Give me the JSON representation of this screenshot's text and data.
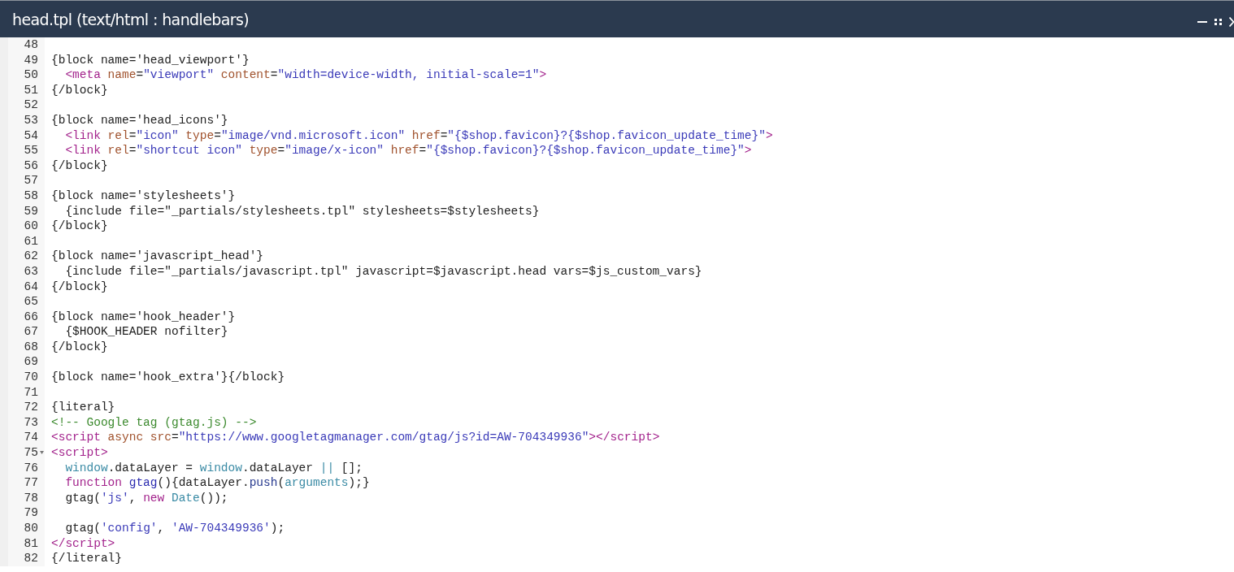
{
  "window": {
    "title": "head.tpl (text/html : handlebars)"
  },
  "editor": {
    "lines": [
      {
        "number": "48",
        "foldable": false
      },
      {
        "number": "49",
        "foldable": false,
        "tokens": [
          {
            "kind": "plain",
            "text": "{block name='head_viewport'}"
          }
        ]
      },
      {
        "number": "50",
        "foldable": false,
        "tokens": [
          {
            "kind": "tag",
            "text": "  <meta"
          },
          {
            "kind": "attr",
            "text": " name"
          },
          {
            "kind": "plain",
            "text": "="
          },
          {
            "kind": "string",
            "text": "\"viewport\""
          },
          {
            "kind": "attr",
            "text": " content"
          },
          {
            "kind": "plain",
            "text": "="
          },
          {
            "kind": "string",
            "text": "\"width=device-width, initial-scale=1\""
          },
          {
            "kind": "tag",
            "text": ">"
          }
        ]
      },
      {
        "number": "51",
        "foldable": false,
        "tokens": [
          {
            "kind": "plain",
            "text": "{/block}"
          }
        ]
      },
      {
        "number": "52",
        "foldable": false
      },
      {
        "number": "53",
        "foldable": false,
        "tokens": [
          {
            "kind": "plain",
            "text": "{block name='head_icons'}"
          }
        ]
      },
      {
        "number": "54",
        "foldable": false,
        "tokens": [
          {
            "kind": "tag",
            "text": "  <link"
          },
          {
            "kind": "attr",
            "text": " rel"
          },
          {
            "kind": "plain",
            "text": "="
          },
          {
            "kind": "string",
            "text": "\"icon\""
          },
          {
            "kind": "attr",
            "text": " type"
          },
          {
            "kind": "plain",
            "text": "="
          },
          {
            "kind": "string",
            "text": "\"image/vnd.microsoft.icon\""
          },
          {
            "kind": "attr",
            "text": " href"
          },
          {
            "kind": "plain",
            "text": "="
          },
          {
            "kind": "string",
            "text": "\"{$shop.favicon}?{$shop.favicon_update_time}\""
          },
          {
            "kind": "tag",
            "text": ">"
          }
        ]
      },
      {
        "number": "55",
        "foldable": false,
        "tokens": [
          {
            "kind": "tag",
            "text": "  <link"
          },
          {
            "kind": "attr",
            "text": " rel"
          },
          {
            "kind": "plain",
            "text": "="
          },
          {
            "kind": "string",
            "text": "\"shortcut icon\""
          },
          {
            "kind": "attr",
            "text": " type"
          },
          {
            "kind": "plain",
            "text": "="
          },
          {
            "kind": "string",
            "text": "\"image/x-icon\""
          },
          {
            "kind": "attr",
            "text": " href"
          },
          {
            "kind": "plain",
            "text": "="
          },
          {
            "kind": "string",
            "text": "\"{$shop.favicon}?{$shop.favicon_update_time}\""
          },
          {
            "kind": "tag",
            "text": ">"
          }
        ]
      },
      {
        "number": "56",
        "foldable": false,
        "tokens": [
          {
            "kind": "plain",
            "text": "{/block}"
          }
        ]
      },
      {
        "number": "57",
        "foldable": false
      },
      {
        "number": "58",
        "foldable": false,
        "tokens": [
          {
            "kind": "plain",
            "text": "{block name='stylesheets'}"
          }
        ]
      },
      {
        "number": "59",
        "foldable": false,
        "tokens": [
          {
            "kind": "plain",
            "text": "  {include file=\"_partials/stylesheets.tpl\" stylesheets=$stylesheets}"
          }
        ]
      },
      {
        "number": "60",
        "foldable": false,
        "tokens": [
          {
            "kind": "plain",
            "text": "{/block}"
          }
        ]
      },
      {
        "number": "61",
        "foldable": false
      },
      {
        "number": "62",
        "foldable": false,
        "tokens": [
          {
            "kind": "plain",
            "text": "{block name='javascript_head'}"
          }
        ]
      },
      {
        "number": "63",
        "foldable": false,
        "tokens": [
          {
            "kind": "plain",
            "text": "  {include file=\"_partials/javascript.tpl\" javascript=$javascript.head vars=$js_custom_vars}"
          }
        ]
      },
      {
        "number": "64",
        "foldable": false,
        "tokens": [
          {
            "kind": "plain",
            "text": "{/block}"
          }
        ]
      },
      {
        "number": "65",
        "foldable": false
      },
      {
        "number": "66",
        "foldable": false,
        "tokens": [
          {
            "kind": "plain",
            "text": "{block name='hook_header'}"
          }
        ]
      },
      {
        "number": "67",
        "foldable": false,
        "tokens": [
          {
            "kind": "plain",
            "text": "  {$HOOK_HEADER nofilter}"
          }
        ]
      },
      {
        "number": "68",
        "foldable": false,
        "tokens": [
          {
            "kind": "plain",
            "text": "{/block}"
          }
        ]
      },
      {
        "number": "69",
        "foldable": false
      },
      {
        "number": "70",
        "foldable": false,
        "tokens": [
          {
            "kind": "plain",
            "text": "{block name='hook_extra'}{/block}"
          }
        ]
      },
      {
        "number": "71",
        "foldable": false
      },
      {
        "number": "72",
        "foldable": false,
        "tokens": [
          {
            "kind": "plain",
            "text": "{literal}"
          }
        ]
      },
      {
        "number": "73",
        "foldable": false,
        "tokens": [
          {
            "kind": "comment",
            "text": "<!-- Google tag (gtag.js) -->"
          }
        ]
      },
      {
        "number": "74",
        "foldable": false,
        "tokens": [
          {
            "kind": "tag",
            "text": "<script"
          },
          {
            "kind": "attr",
            "text": " async"
          },
          {
            "kind": "attr",
            "text": " src"
          },
          {
            "kind": "plain",
            "text": "="
          },
          {
            "kind": "string",
            "text": "\"https://www.googletagmanager.com/gtag/js?id=AW-704349936\""
          },
          {
            "kind": "tag",
            "text": "></script>"
          }
        ]
      },
      {
        "number": "75",
        "foldable": true,
        "tokens": [
          {
            "kind": "tag",
            "text": "<script>"
          }
        ]
      },
      {
        "number": "76",
        "foldable": false,
        "tokens": [
          {
            "kind": "variable",
            "text": "  window"
          },
          {
            "kind": "plain",
            "text": ".dataLayer = "
          },
          {
            "kind": "variable",
            "text": "window"
          },
          {
            "kind": "plain",
            "text": ".dataLayer "
          },
          {
            "kind": "operator",
            "text": "||"
          },
          {
            "kind": "plain",
            "text": " [];"
          }
        ]
      },
      {
        "number": "77",
        "foldable": false,
        "tokens": [
          {
            "kind": "keyword",
            "text": "  function"
          },
          {
            "kind": "def",
            "text": " gtag"
          },
          {
            "kind": "plain",
            "text": "(){dataLayer."
          },
          {
            "kind": "property",
            "text": "push"
          },
          {
            "kind": "plain",
            "text": "("
          },
          {
            "kind": "variable",
            "text": "arguments"
          },
          {
            "kind": "plain",
            "text": ");}"
          }
        ]
      },
      {
        "number": "78",
        "foldable": false,
        "tokens": [
          {
            "kind": "plain",
            "text": "  gtag("
          },
          {
            "kind": "string",
            "text": "'js'"
          },
          {
            "kind": "plain",
            "text": ", "
          },
          {
            "kind": "keyword",
            "text": "new"
          },
          {
            "kind": "variable",
            "text": " Date"
          },
          {
            "kind": "plain",
            "text": "());"
          }
        ]
      },
      {
        "number": "79",
        "foldable": false
      },
      {
        "number": "80",
        "foldable": false,
        "tokens": [
          {
            "kind": "plain",
            "text": "  gtag("
          },
          {
            "kind": "string",
            "text": "'config'"
          },
          {
            "kind": "plain",
            "text": ", "
          },
          {
            "kind": "string",
            "text": "'AW-704349936'"
          },
          {
            "kind": "plain",
            "text": ");"
          }
        ]
      },
      {
        "number": "81",
        "foldable": false,
        "tokens": [
          {
            "kind": "tag",
            "text": "</script>"
          }
        ]
      },
      {
        "number": "82",
        "foldable": false,
        "tokens": [
          {
            "kind": "plain",
            "text": "{/literal}"
          }
        ]
      }
    ]
  }
}
